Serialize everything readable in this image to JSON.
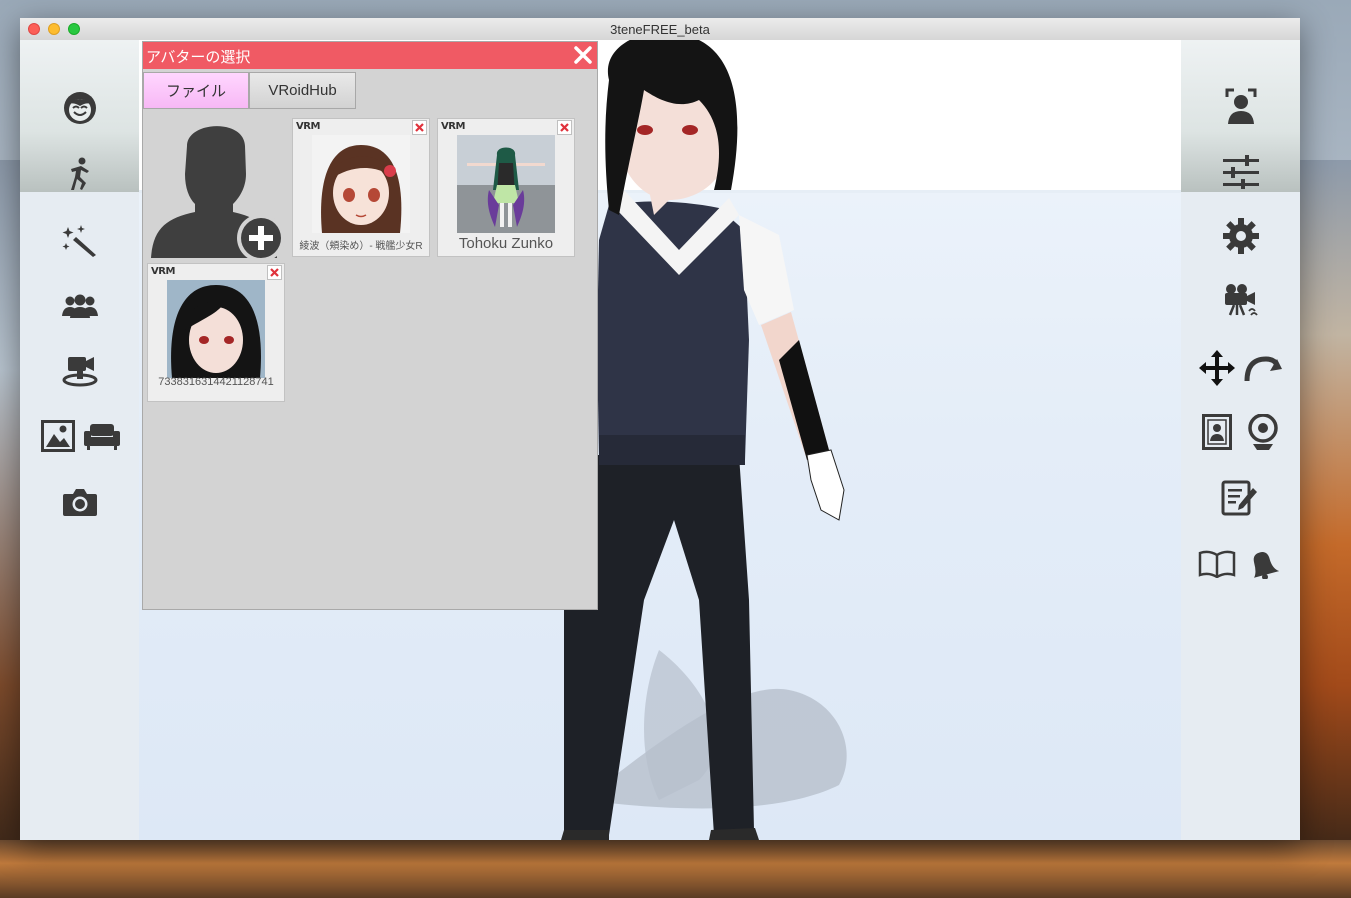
{
  "window": {
    "title": "3teneFREE_beta"
  },
  "dialog": {
    "title": "アバターの選択",
    "tabs": [
      {
        "label": "ファイル"
      },
      {
        "label": "VRoidHub"
      }
    ],
    "avatars": [
      {
        "tag": "VRM",
        "label": "綾波（頬染め）- 戦艦少女R"
      },
      {
        "tag": "VRM",
        "label": "Tohoku Zunko"
      },
      {
        "tag": "VRM",
        "label": "7338316314421128741"
      }
    ]
  },
  "left_toolbar": {
    "icons": [
      "face-icon",
      "pose-icon",
      "effects-wand-icon",
      "group-icon",
      "camera-stage-icon",
      "background-image-icon",
      "sofa-icon",
      "camera-icon"
    ]
  },
  "right_toolbar": {
    "icons": [
      "face-tracking-icon",
      "sliders-icon",
      "gear-icon",
      "video-camera-icon",
      "move-arrows-icon",
      "rotate-icon",
      "portrait-frame-icon",
      "webcam-icon",
      "edit-note-icon",
      "book-icon",
      "bell-icon"
    ]
  },
  "colors": {
    "dialog_header": "#f05a64",
    "active_tab": "#f7b8f5",
    "delete_x": "#e0323c"
  }
}
